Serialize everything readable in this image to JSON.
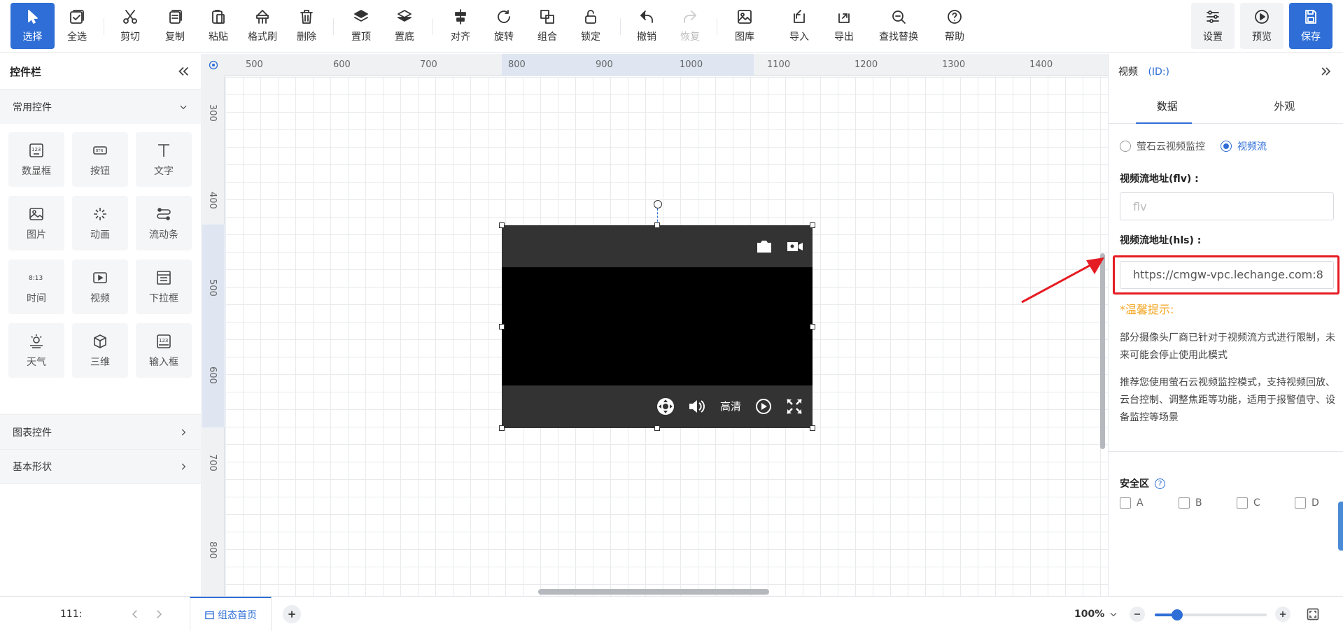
{
  "toolbar": {
    "select": "选择",
    "select_all": "全选",
    "cut": "剪切",
    "copy": "复制",
    "paste": "粘贴",
    "format_brush": "格式刷",
    "delete": "删除",
    "to_top": "置顶",
    "to_bottom": "置底",
    "align": "对齐",
    "rotate": "旋转",
    "group": "组合",
    "lock": "锁定",
    "undo": "撤销",
    "redo": "恢复",
    "library": "图库",
    "import": "导入",
    "export": "导出",
    "find_replace": "查找替换",
    "help": "帮助",
    "settings": "设置",
    "preview": "预览",
    "save": "保存"
  },
  "left_panel": {
    "title": "控件栏",
    "common_title": "常用控件",
    "items": [
      "数显框",
      "按钮",
      "文字",
      "图片",
      "动画",
      "流动条",
      "时间",
      "视频",
      "下拉框",
      "天气",
      "三维",
      "输入框"
    ],
    "chart_title": "图表控件",
    "shape_title": "基本形状"
  },
  "ruler": {
    "h": [
      "500",
      "600",
      "700",
      "800",
      "900",
      "1000",
      "1100",
      "1200",
      "1300",
      "1400"
    ],
    "v": [
      "300",
      "400",
      "500",
      "600",
      "700",
      "800"
    ]
  },
  "video_widget": {
    "quality": "高清"
  },
  "right_panel": {
    "title": "视频",
    "id_label": "(ID:)",
    "tabs": [
      "数据",
      "外观"
    ],
    "radio_ezviz": "萤石云视频监控",
    "radio_stream": "视频流",
    "flv_label": "视频流地址(flv) :",
    "flv_placeholder": "flv",
    "hls_label": "视频流地址(hls) :",
    "hls_value": "https://cmgw-vpc.lechange.com:8",
    "tip_title": "*温馨提示:",
    "tip1": "部分摄像头厂商已针对于视频流方式进行限制，未来可能会停止使用此模式",
    "tip2": "推荐您使用萤石云视频监控模式，支持视频回放、云台控制、调整焦距等功能，适用于报警值守、设备监控等场景",
    "safe_title": "安全区",
    "safe_options": [
      "A",
      "B",
      "C",
      "D"
    ]
  },
  "bottom_bar": {
    "page_count": "111:",
    "page_tab": "组态首页",
    "zoom": "100%",
    "zoom_level": 0.2
  }
}
